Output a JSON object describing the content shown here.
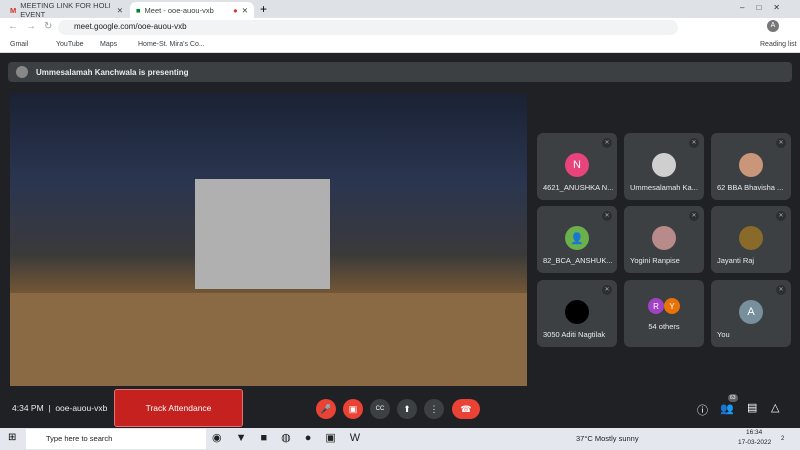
{
  "browser": {
    "tabs": [
      {
        "title": "MEETING LINK FOR HOLI EVENT"
      },
      {
        "title": "Meet - ooe-auou-vxb"
      }
    ],
    "url": "meet.google.com/ooe-auou-vxb",
    "bookmarks": [
      "Gmail",
      "YouTube",
      "Maps",
      "Home-St. Mira's Co..."
    ],
    "reading_list": "Reading list",
    "profile_initial": "A"
  },
  "meet": {
    "presenting": "Ummesalamah Kanchwala is presenting",
    "participants": [
      {
        "name": "4621_ANUSHKA N...",
        "initial": "N",
        "color": "#e8437a"
      },
      {
        "name": "Ummesalamah Ka...",
        "initial": "",
        "color": "#cfcfcf"
      },
      {
        "name": "62 BBA Bhavisha ...",
        "initial": "",
        "color": "#c9967a"
      },
      {
        "name": "82_BCA_ANSHUK...",
        "initial": "",
        "color": "#6ab04c"
      },
      {
        "name": "Yogini Ranpise",
        "initial": "",
        "color": "#b88a8a"
      },
      {
        "name": "Jayanti Raj",
        "initial": "",
        "color": "#8a6a2a"
      },
      {
        "name": "3050 Aditi Nagtilak",
        "initial": "",
        "color": "#000000"
      }
    ],
    "others": {
      "label": "54 others",
      "initials": [
        "R",
        "Y"
      ]
    },
    "you": {
      "name": "You",
      "initial": "A"
    },
    "time": "4:34 PM",
    "code": "ooe-auou-vxb",
    "track": "Track Attendance",
    "people_count": "63"
  },
  "taskbar": {
    "search": "Type here to search",
    "weather": "37°C  Mostly sunny",
    "time": "16:34",
    "date": "17-03-2022",
    "notif": "2"
  }
}
